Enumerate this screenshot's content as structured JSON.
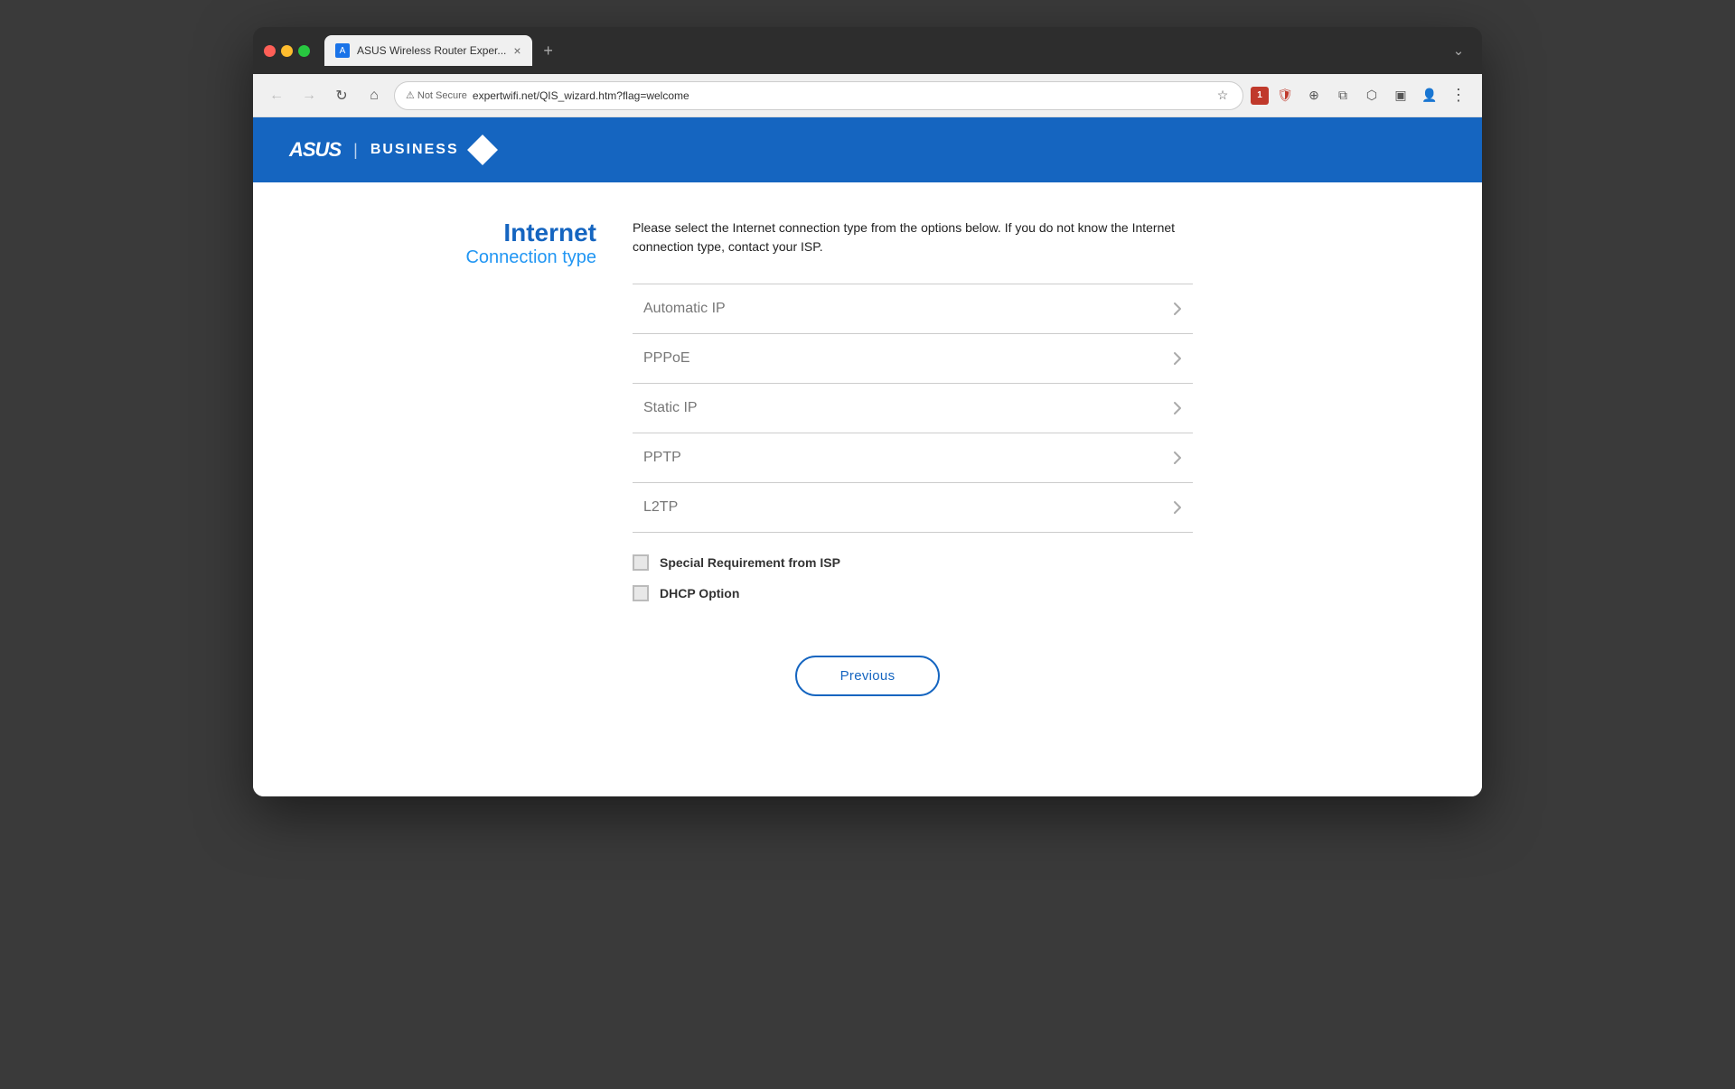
{
  "browser": {
    "tab_title": "ASUS Wireless Router Exper...",
    "close_label": "×",
    "new_tab_label": "+",
    "nav": {
      "back_label": "←",
      "forward_label": "→",
      "reload_label": "↻",
      "home_label": "⌂"
    },
    "address_bar": {
      "not_secure_label": "Not Secure",
      "url": "expertwifi.net/QIS_wizard.htm?flag=welcome"
    },
    "toolbar_chevron": "❯",
    "dropdown_label": "⌄"
  },
  "header": {
    "asus_label": "ASUS",
    "separator": "|",
    "business_label": "BUSINESS"
  },
  "page": {
    "title_line1": "Internet",
    "title_line2": "Connection type",
    "description": "Please select the Internet connection type from the options below. If you do not know the Internet connection type, contact your ISP.",
    "connection_types": [
      {
        "label": "Automatic IP"
      },
      {
        "label": "PPPoE"
      },
      {
        "label": "Static IP"
      },
      {
        "label": "PPTP"
      },
      {
        "label": "L2TP"
      }
    ],
    "checkboxes": [
      {
        "label": "Special Requirement from ISP",
        "checked": false
      },
      {
        "label": "DHCP Option",
        "checked": false
      }
    ],
    "previous_button_label": "Previous"
  }
}
